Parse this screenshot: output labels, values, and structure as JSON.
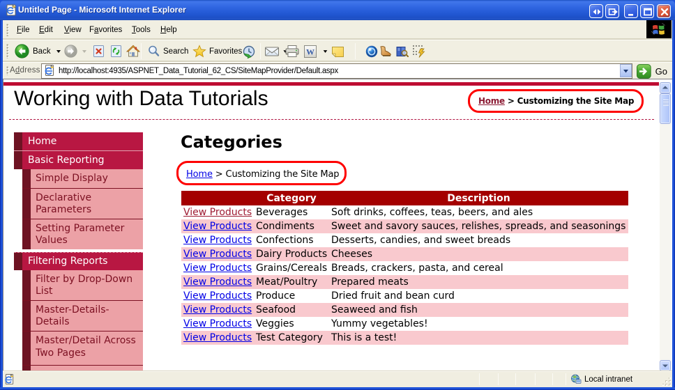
{
  "window": {
    "title": "Untitled Page - Microsoft Internet Explorer"
  },
  "menu": {
    "items": [
      {
        "label": "File",
        "accel": 0
      },
      {
        "label": "Edit",
        "accel": 0
      },
      {
        "label": "View",
        "accel": 0
      },
      {
        "label": "Favorites",
        "accel": 1
      },
      {
        "label": "Tools",
        "accel": 0
      },
      {
        "label": "Help",
        "accel": 0
      }
    ]
  },
  "toolbar": {
    "back_label": "Back",
    "search_label": "Search",
    "favorites_label": "Favorites"
  },
  "address": {
    "label": "Address",
    "url": "http://localhost:4935/ASPNET_Data_Tutorial_62_CS/SiteMapProvider/Default.aspx",
    "go_label": "Go"
  },
  "page": {
    "heading": "Working with Data Tutorials",
    "breadcrumb_top": {
      "home": "Home",
      "separator": ">",
      "current": "Customizing the Site Map"
    },
    "content_title": "Categories",
    "breadcrumb_content": {
      "home": "Home",
      "separator": ">",
      "current": "Customizing the Site Map"
    }
  },
  "sidebar": {
    "items": [
      {
        "label": "Home",
        "level": 1
      },
      {
        "label": "Basic Reporting",
        "level": 1
      },
      {
        "label": "Simple Display",
        "level": 2
      },
      {
        "label": "Declarative Parameters",
        "level": 2
      },
      {
        "label": "Setting Parameter Values",
        "level": 2
      },
      {
        "label": "Filtering Reports",
        "level": 1
      },
      {
        "label": "Filter by Drop-Down List",
        "level": 2
      },
      {
        "label": "Master-Details-Details",
        "level": 2
      },
      {
        "label": "Master/Detail Across Two Pages",
        "level": 2
      }
    ]
  },
  "table": {
    "headers": [
      "",
      "Category",
      "Description"
    ],
    "link_label": "View Products",
    "rows": [
      {
        "category": "Beverages",
        "description": "Soft drinks, coffees, teas, beers, and ales"
      },
      {
        "category": "Condiments",
        "description": "Sweet and savory sauces, relishes, spreads, and seasonings"
      },
      {
        "category": "Confections",
        "description": "Desserts, candies, and sweet breads"
      },
      {
        "category": "Dairy Products",
        "description": "Cheeses"
      },
      {
        "category": "Grains/Cereals",
        "description": "Breads, crackers, pasta, and cereal"
      },
      {
        "category": "Meat/Poultry",
        "description": "Prepared meats"
      },
      {
        "category": "Produce",
        "description": "Dried fruit and bean curd"
      },
      {
        "category": "Seafood",
        "description": "Seaweed and fish"
      },
      {
        "category": "Veggies",
        "description": "Yummy vegetables!"
      },
      {
        "category": "Test Category",
        "description": "This is a test!"
      }
    ]
  },
  "statusbar": {
    "zone_label": "Local intranet"
  },
  "colors": {
    "titlebar_blue": "#2a60dc",
    "chrome_beige": "#f1efe2",
    "page_topbar_red": "#be0c32",
    "sidebar_level1_bg": "#b81742",
    "sidebar_level2_bg": "#eca1a6",
    "sidebar_gutter": "#6e1323",
    "table_header_bg": "#a40000",
    "table_alt_row_pink": "#f9c9ce",
    "link_blue": "#0000e6",
    "visited_link_maroon": "#9e1b32",
    "annotation_red": "#fe0000"
  }
}
